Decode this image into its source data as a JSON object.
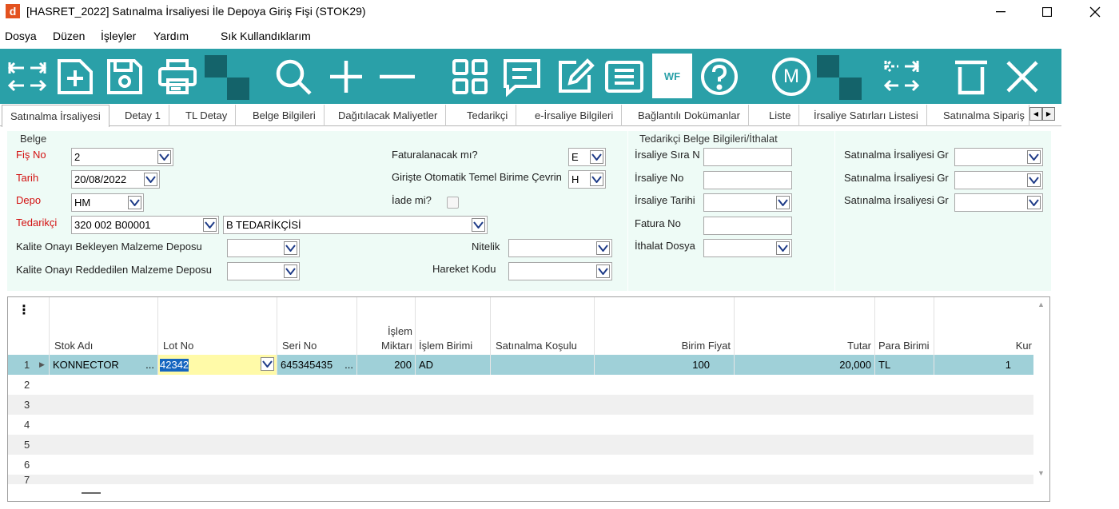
{
  "window": {
    "logo": "d",
    "title": "[HASRET_2022] Satınalma İrsaliyesi İle Depoya Giriş Fişi (STOK29)"
  },
  "menu": {
    "items": [
      "Dosya",
      "Düzen",
      "İşleyler",
      "Yardım",
      "Sık Kullandıklarım"
    ]
  },
  "toolbar": {
    "wf_label": "WF",
    "m_label": "M",
    "icons": [
      "swap-arrows-icon",
      "new-document-icon",
      "save-icon",
      "print-icon",
      "search-icon",
      "add-icon",
      "remove-icon",
      "grid-view-icon",
      "message-icon",
      "edit-icon",
      "list-icon",
      "workflow-icon",
      "help-icon",
      "m-icon",
      "expand-arrows-icon",
      "delete-icon",
      "close-icon"
    ],
    "accent": "#2aa0a8"
  },
  "tabs": [
    "Satınalma İrsaliyesi",
    "Detay 1",
    "TL Detay",
    "Belge Bilgileri",
    "Dağıtılacak Maliyetler",
    "Tedarikçi",
    "e-İrsaliye Bilgileri",
    "Bağlantılı Dokümanlar",
    "Liste",
    "İrsaliye Satırları Listesi",
    "Satınalma Sipariş"
  ],
  "belge": {
    "group_title": "Belge",
    "fis_no_label": "Fiş No",
    "fis_no_value": "2",
    "tarih_label": "Tarih",
    "tarih_value": "20/08/2022",
    "depo_label": "Depo",
    "depo_value": "HM",
    "tedarikci_label": "Tedarikçi",
    "tedarikci_code": "320 002 B00001",
    "tedarikci_name": "B TEDARİKÇİSİ",
    "kalite_bekleyen_label": "Kalite Onayı Bekleyen Malzeme  Deposu",
    "kalite_reddedilen_label": "Kalite Onayı Reddedilen Malzeme Deposu",
    "faturalanacak_label": "Faturalanacak mı?",
    "faturalanacak_value": "E",
    "giriste_label": "Girişte Otomatik Temel Birime Çevrin",
    "giriste_value": "H",
    "iade_label": "İade mi?",
    "nitelik_label": "Nitelik",
    "hareket_kodu_label": "Hareket Kodu"
  },
  "tedarikci_belge": {
    "group_title": "Tedarikçi Belge Bilgileri/İthalat",
    "irsaliye_sira_label": "İrsaliye Sıra N",
    "irsaliye_no_label": "İrsaliye No",
    "irsaliye_tarihi_label": "İrsaliye Tarihi",
    "fatura_no_label": "Fatura No",
    "ithalat_dosya_label": "İthalat Dosya"
  },
  "right_group": {
    "labels": [
      "Satınalma İrsaliyesi Gr",
      "Satınalma İrsaliyesi Gr",
      "Satınalma İrsaliyesi Gr"
    ]
  },
  "grid": {
    "menu_glyph": "⋮",
    "columns": [
      "Stok Adı",
      "Lot No",
      "Seri No",
      "İşlem",
      "Miktarı",
      "İşlem Birimi",
      "Satınalma Koşulu",
      "Birim Fiyat",
      "Tutar",
      "Para Birimi",
      "Kur"
    ],
    "row1": {
      "num": "1",
      "stok_adi": "KONNECTOR",
      "lot_no": "42342",
      "seri_no": "645345435",
      "miktar": "200",
      "islem_birimi": "AD",
      "satinalma_kosulu": "",
      "birim_fiyat": "100",
      "tutar": "20,000",
      "para_birimi": "TL",
      "kur": "1"
    },
    "row_numbers": [
      "2",
      "3",
      "4",
      "5",
      "6",
      "7"
    ],
    "ellipsis": "..."
  }
}
